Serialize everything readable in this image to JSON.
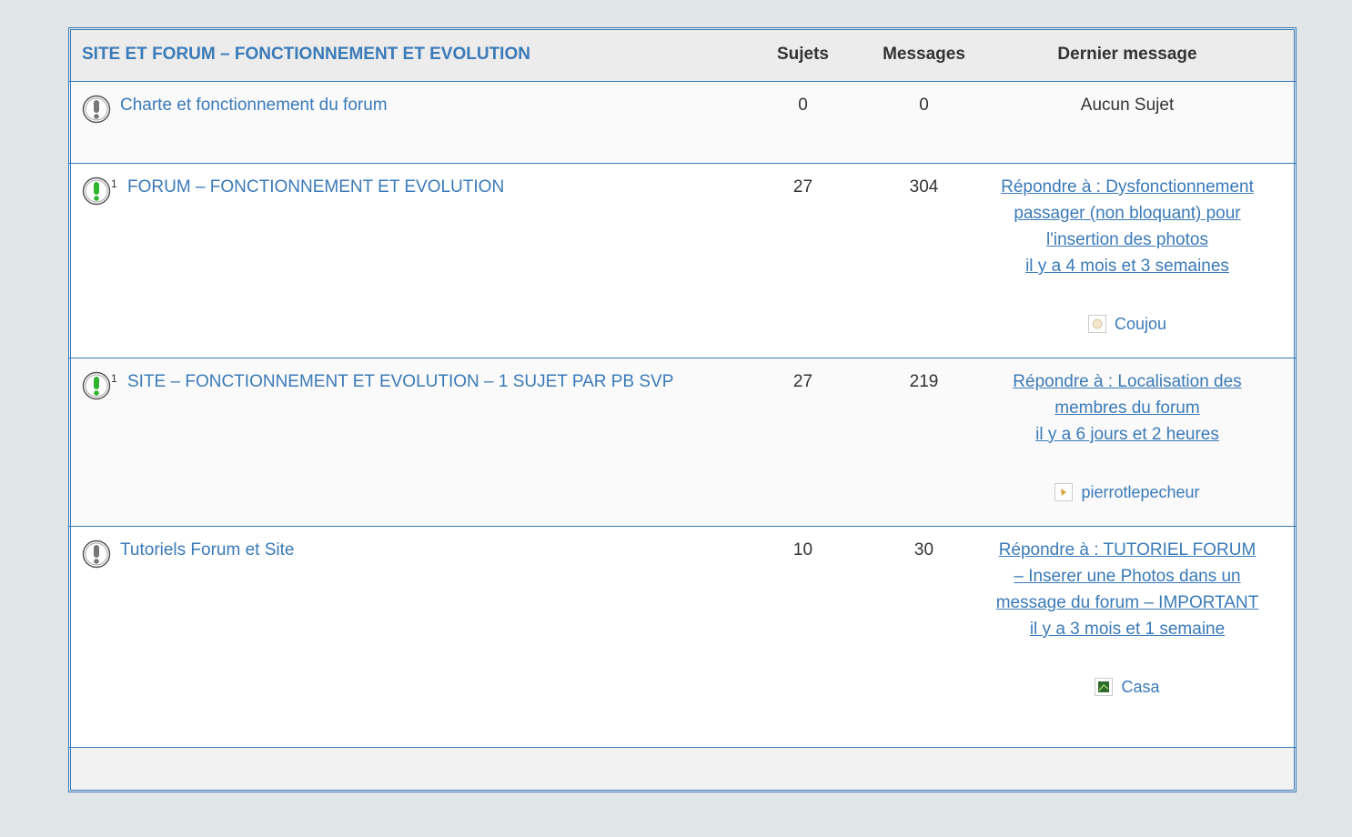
{
  "category": {
    "title": "SITE ET FORUM – FONCTIONNEMENT ET EVOLUTION",
    "columns": {
      "topics": "Sujets",
      "posts": "Messages",
      "last_post": "Dernier message"
    }
  },
  "forums": [
    {
      "name": "Charte et fonctionnement du forum",
      "icon": "exclamation-grey-icon",
      "subforum_count": "",
      "topics": "0",
      "posts": "0",
      "last_post": {
        "none": "Aucun Sujet"
      }
    },
    {
      "name": "FORUM – FONCTIONNEMENT ET EVOLUTION",
      "icon": "exclamation-green-icon",
      "subforum_count": "1",
      "topics": "27",
      "posts": "304",
      "last_post": {
        "title": "Répondre à : Dysfonctionnement passager (non bloquant) pour l'insertion des photos",
        "time": "il y a 4 mois et 3 semaines",
        "author": "Coujou"
      }
    },
    {
      "name": "SITE – FONCTIONNEMENT ET EVOLUTION – 1 SUJET PAR PB SVP",
      "icon": "exclamation-green-icon",
      "subforum_count": "1",
      "topics": "27",
      "posts": "219",
      "last_post": {
        "title": "Répondre à : Localisation des membres du forum",
        "time": "il y a 6 jours et 2 heures",
        "author": "pierrotlepecheur"
      }
    },
    {
      "name": "Tutoriels Forum et Site",
      "icon": "exclamation-grey-icon",
      "subforum_count": "",
      "topics": "10",
      "posts": "30",
      "last_post": {
        "title": "Répondre à : TUTORIEL FORUM – Inserer une Photos dans un message du forum – IMPORTANT",
        "time": "il y a 3 mois et 1 semaine",
        "author": "Casa"
      }
    }
  ],
  "colors": {
    "link": "#3a7ab8",
    "border": "#3a7ab8",
    "page_bg": "#e0e5e8",
    "header_bg": "#ececec",
    "active_icon": "#2fb52f"
  }
}
